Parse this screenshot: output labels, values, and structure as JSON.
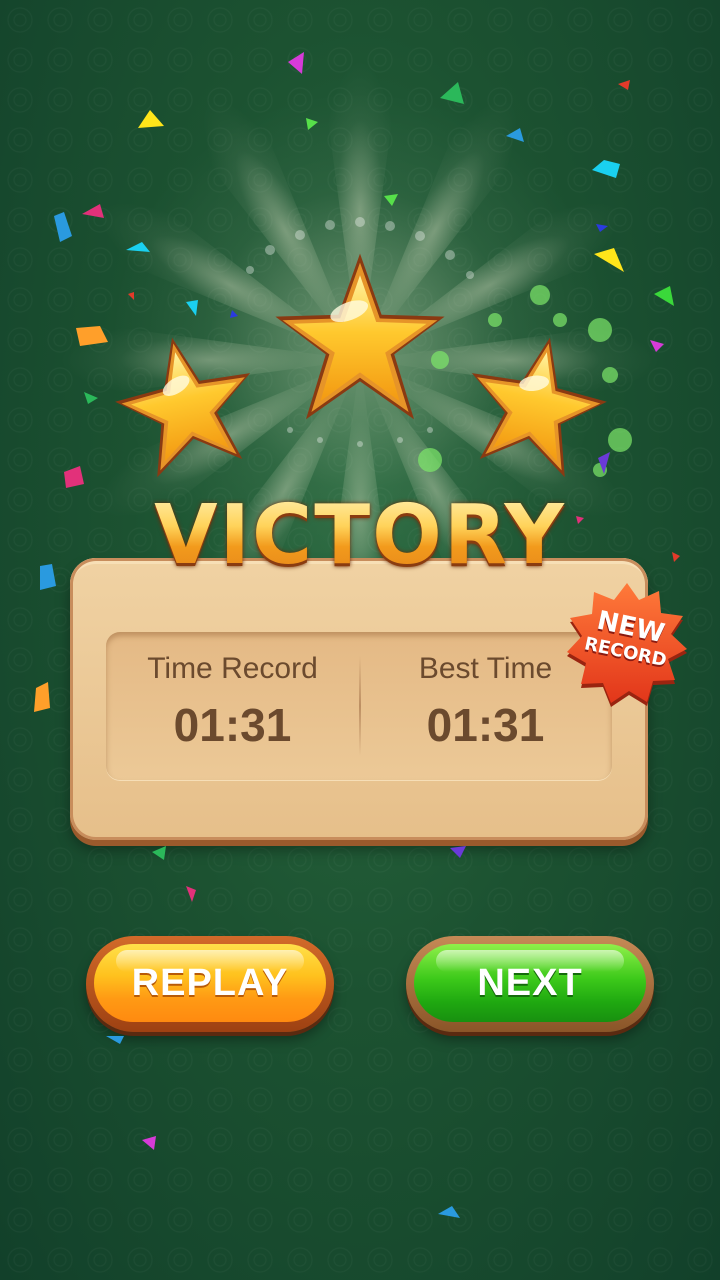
{
  "screen": {
    "title": "VICTORY",
    "stars_earned": 3,
    "stars_total": 3
  },
  "stats": {
    "time_record_label": "Time Record",
    "time_record_value": "01:31",
    "best_time_label": "Best Time",
    "best_time_value": "01:31"
  },
  "badge": {
    "line1": "NEW",
    "line2": "RECORD"
  },
  "buttons": {
    "replay_label": "REPLAY",
    "next_label": "NEXT"
  },
  "colors": {
    "background": "#1c5231",
    "panel": "#e6bf8a",
    "replay": "#ffb21e",
    "next": "#3cc91a",
    "badge": "#ee4a22",
    "star": "#ffc22a"
  },
  "icons": [
    "star-icon",
    "new-record-badge"
  ]
}
